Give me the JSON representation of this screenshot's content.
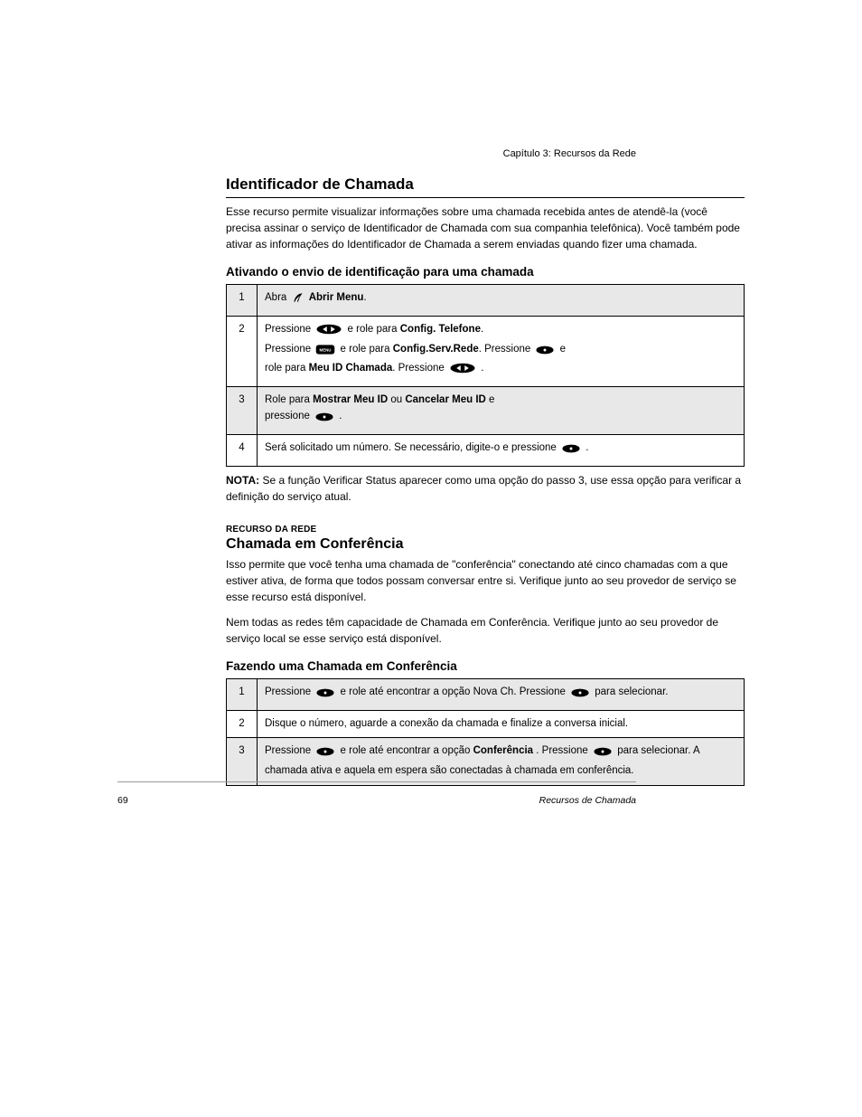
{
  "breadcrumb": "Capítulo 3: Recursos da Rede",
  "sections": {
    "cid": {
      "title": "Identificador de Chamada",
      "intro": "Esse recurso permite visualizar informações sobre uma chamada recebida antes de atendê-la (você precisa assinar o serviço de Identificador de Chamada com sua companhia telefônica). Você também pode ativar as informações do Identificador de Chamada a serem enviadas quando fizer uma chamada.",
      "sub": "Ativando o envio de identificação para uma chamada",
      "table": {
        "row1": {
          "pre": "Abra ",
          "bold": " Abrir Menu",
          "post": "."
        },
        "row2": {
          "a_pre": "Pressione ",
          "a_post": " e role para ",
          "a_target": "Config. Telefone",
          "a_end": ".",
          "b_pre": "Pressione ",
          "b_mid": " e role para ",
          "b_target": "Config.Serv.Rede",
          "b_end": ". Pressione  e role para ",
          "b_target2": "Meu ID Chamada",
          "b_close": ". Pressione ",
          "b_after": "."
        },
        "row3_pre": "Role para ",
        "row3_bold": "Mostrar Meu ID",
        "row3_mid": " ou ",
        "row3_bold2": "Cancelar Meu ID",
        "row3_post": " e pressione ",
        "row3_end": ".",
        "row4_pre": "Será solicitado um número. Se necessário, digite-o e pressione ",
        "row4_end": "."
      },
      "note_label": "NOTA: ",
      "note_text": "Se a função Verificar Status aparecer como uma opção do passo 3, use essa opção para verificar a definição do serviço atual."
    },
    "feat": {
      "tiny": "RECURSO DA REDE",
      "title": "Chamada em Conferência",
      "intro1": "Isso permite que você tenha uma chamada de \"conferência\" conectando até cinco chamadas com a que estiver ativa, de forma que todos possam conversar entre si. Verifique junto ao seu provedor de serviço se esse recurso está disponível.",
      "intro2": "Nem todas as redes têm capacidade de Chamada em Conferência. Verifique junto ao seu provedor de serviço local se esse serviço está disponível.",
      "sub": "Fazendo uma Chamada em Conferência",
      "table": {
        "row1_pre": "Pressione ",
        "row1_mid": " e role até encontrar a opção Nova Ch. Pressione ",
        "row1_post": " para selecionar.",
        "row2": "Disque o número, aguarde a conexão da chamada e finalize a conversa inicial.",
        "row3_pre": "Pressione ",
        "row3_mid": " e role até encontrar a opção ",
        "row3_bold": "Conferência",
        "row3_post": ". Pressione  para selecionar. A chamada ativa e aquela em espera são conectadas à chamada em conferência."
      }
    }
  },
  "page_left": "69",
  "page_right": "Recursos de Chamada",
  "icons": {
    "feather": "feather-icon",
    "arrows": "left-right-arrows-icon",
    "menu": "menu-button-icon",
    "enter": "enter-ok-button-icon"
  }
}
